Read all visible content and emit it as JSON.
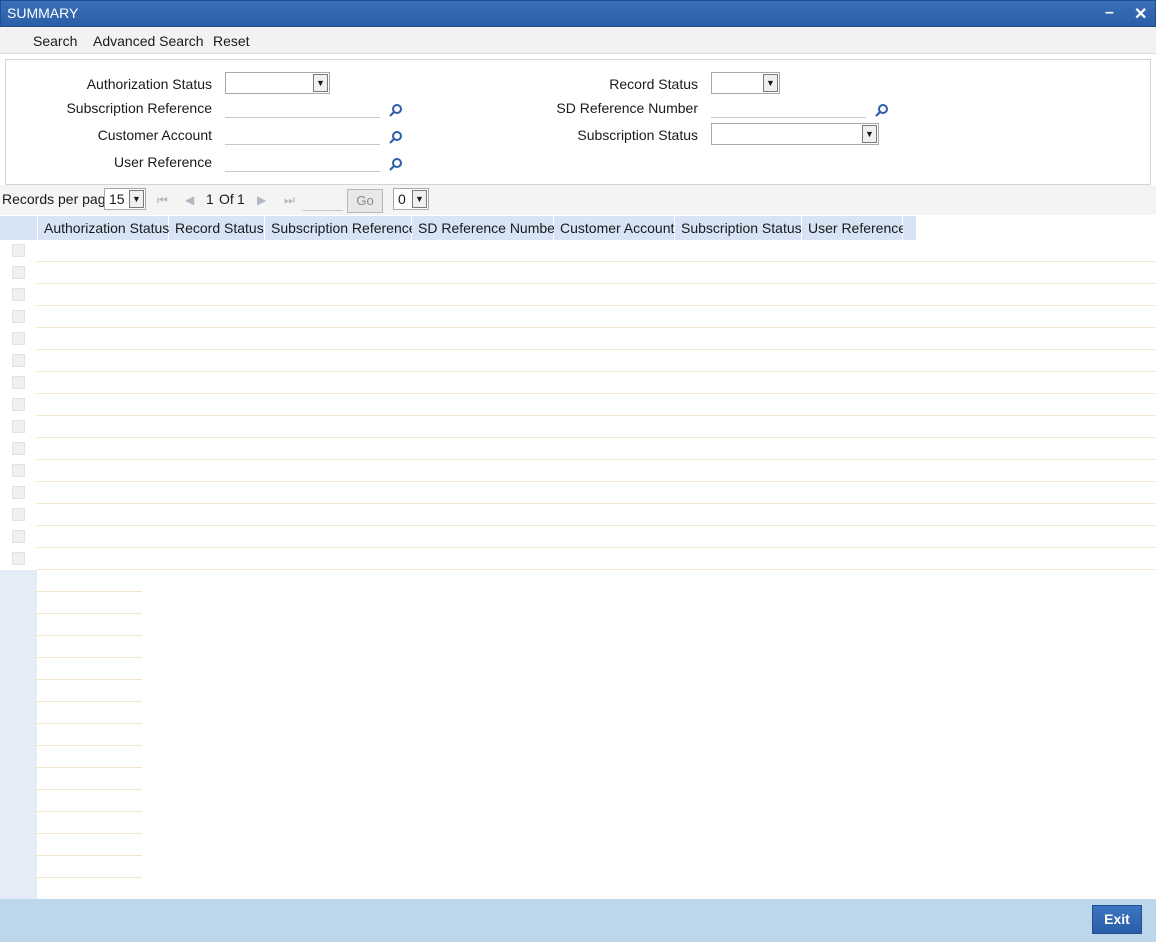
{
  "window": {
    "title": "SUMMARY",
    "minimize_label": "–",
    "close_label": "✕"
  },
  "toolbar": {
    "search": "Search",
    "advanced_search": "Advanced Search",
    "reset": "Reset"
  },
  "filters": {
    "authorization_status": {
      "label": "Authorization Status",
      "value": ""
    },
    "subscription_reference": {
      "label": "Subscription Reference",
      "value": ""
    },
    "customer_account": {
      "label": "Customer Account",
      "value": ""
    },
    "user_reference": {
      "label": "User Reference",
      "value": ""
    },
    "record_status": {
      "label": "Record Status",
      "value": ""
    },
    "sd_reference_number": {
      "label": "SD Reference Number",
      "value": ""
    },
    "subscription_status": {
      "label": "Subscription Status",
      "value": ""
    }
  },
  "pager": {
    "records_per_page_label": "Records per page",
    "records_per_page_value": "15",
    "current_page": "1",
    "of_label": "Of",
    "total_pages": "1",
    "go_label": "Go",
    "extra_select_value": "0"
  },
  "grid": {
    "columns": [
      "Authorization Status",
      "Record Status",
      "Subscription Reference",
      "SD Reference Number",
      "Customer Account",
      "Subscription Status",
      "User Reference"
    ]
  },
  "footer": {
    "exit_label": "Exit"
  },
  "colors": {
    "title_bar": "#2b5ea7",
    "header_cell": "#d6e4f5",
    "footer": "#bcd6ec",
    "exit_button": "#2a5ea8"
  },
  "icons": {
    "lookup": "magnifier-icon",
    "first": "first-page-icon",
    "prev": "prev-page-icon",
    "next": "next-page-icon",
    "last": "last-page-icon"
  }
}
